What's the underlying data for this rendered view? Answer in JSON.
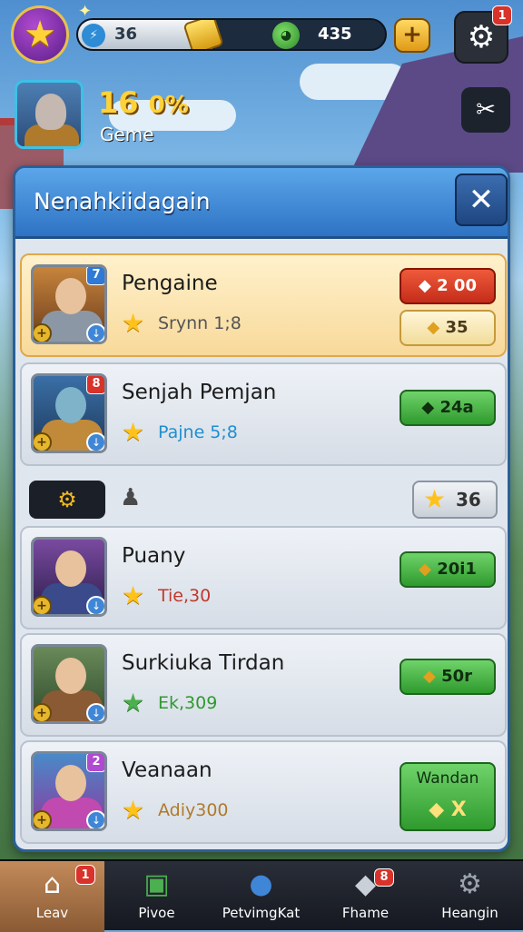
{
  "top": {
    "gems": "36",
    "slime_count": "435",
    "plus": "+",
    "settings_badge": "1",
    "sparkle": "✦"
  },
  "profile": {
    "level": "16",
    "percent": "0%",
    "label": "Geme"
  },
  "panel": {
    "title": "Nenahkiidagain",
    "close": "✕"
  },
  "rows": [
    {
      "name": "Pengaine",
      "badge": "7",
      "badge_color": "#2f7ad6",
      "sub": "Srynn 1;8",
      "sub_color": "#555555",
      "action": "2 00",
      "action2": "35"
    },
    {
      "name": "Senjah Pemjan",
      "badge": "8",
      "badge_color": "#d8322a",
      "sub": "Pajne 5;8",
      "sub_color": "#1f8fd0",
      "action": "24a"
    },
    {
      "name": "Puany",
      "sub": "Tie,30",
      "sub_color": "#c0392b",
      "action": "20i1"
    },
    {
      "name": "Surkiuka Tirdan",
      "sub": "Ek,309",
      "sub_color": "#2e9a2e",
      "action": "50r"
    },
    {
      "name": "Veanaan",
      "badge": "2",
      "badge_color": "#b04ad0",
      "sub": "Adiy300",
      "sub_color": "#b07a2c",
      "action_title": "Wandan",
      "action_sub": "X"
    }
  ],
  "midbar": {
    "stars": "36"
  },
  "nav": {
    "items": [
      {
        "label": "Leav",
        "icon": "⌂",
        "badge": "1"
      },
      {
        "label": "Pivoe",
        "icon": "▣"
      },
      {
        "label": "PetvimgKat",
        "icon": "●"
      },
      {
        "label": "Fhame",
        "icon": "◆",
        "badge": "8"
      },
      {
        "label": "Heangin",
        "icon": "⚙"
      }
    ]
  }
}
